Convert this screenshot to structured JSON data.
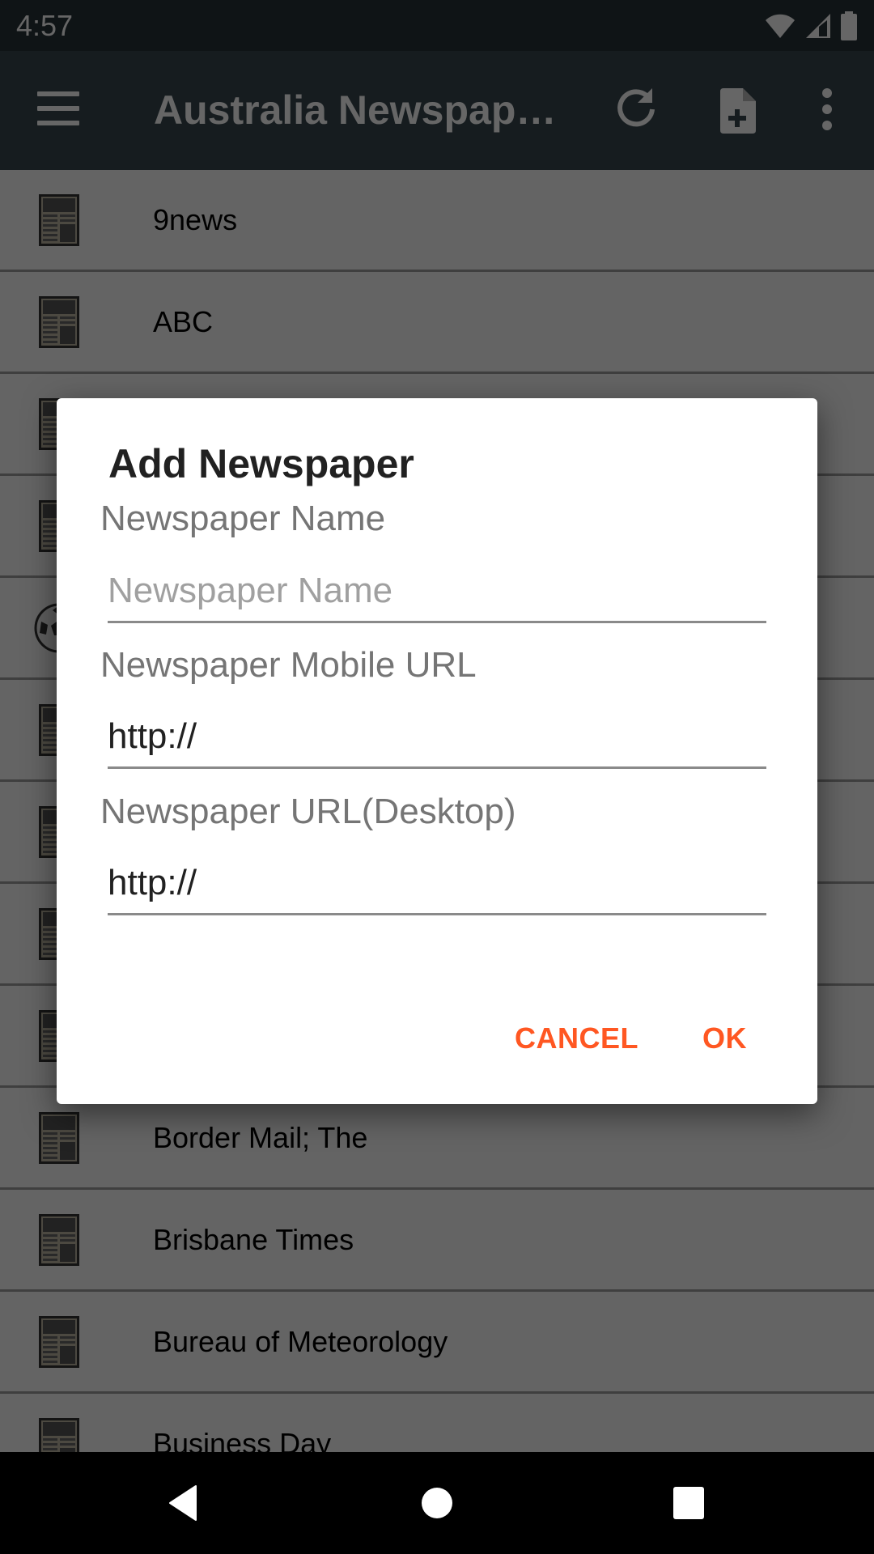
{
  "status_bar": {
    "time": "4:57",
    "icons": [
      "wifi-icon",
      "cell-signal-icon",
      "battery-icon"
    ]
  },
  "app_bar": {
    "title": "Australia Newspapers",
    "actions": [
      {
        "name": "menu",
        "icon": "hamburger-menu-icon"
      },
      {
        "name": "refresh",
        "icon": "refresh-icon"
      },
      {
        "name": "add-newspaper",
        "icon": "note-add-icon"
      },
      {
        "name": "more-options",
        "icon": "more-vert-icon"
      }
    ]
  },
  "list": {
    "items": [
      {
        "label": "9news",
        "icon": "newspaper-icon"
      },
      {
        "label": "ABC",
        "icon": "newspaper-icon"
      },
      {
        "label": "",
        "icon": "newspaper-icon"
      },
      {
        "label": "",
        "icon": "newspaper-icon"
      },
      {
        "label": "",
        "icon": "soccer-ball-icon"
      },
      {
        "label": "",
        "icon": "newspaper-icon"
      },
      {
        "label": "",
        "icon": "newspaper-icon"
      },
      {
        "label": "",
        "icon": "newspaper-icon"
      },
      {
        "label": "",
        "icon": "newspaper-icon"
      },
      {
        "label": "Border Mail; The",
        "icon": "newspaper-icon"
      },
      {
        "label": "Brisbane Times",
        "icon": "newspaper-icon"
      },
      {
        "label": "Bureau of Meteorology",
        "icon": "newspaper-icon"
      },
      {
        "label": "Business Day",
        "icon": "newspaper-icon"
      }
    ]
  },
  "dialog": {
    "title": "Add Newspaper",
    "fields": [
      {
        "label": "Newspaper Name",
        "value": "",
        "placeholder": "Newspaper Name"
      },
      {
        "label": "Newspaper Mobile URL",
        "value": "http://",
        "placeholder": ""
      },
      {
        "label": "Newspaper URL(Desktop)",
        "value": "http://",
        "placeholder": ""
      }
    ],
    "buttons": {
      "cancel": "CANCEL",
      "ok": "OK"
    },
    "accent_color": "#ff5722"
  },
  "nav_bar": {
    "buttons": [
      "back",
      "home",
      "recents"
    ]
  }
}
